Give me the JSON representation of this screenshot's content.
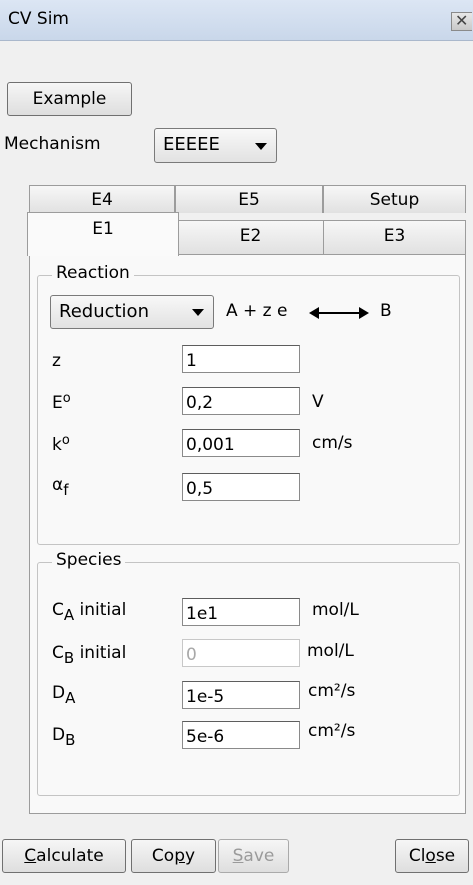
{
  "window": {
    "title": "CV Sim",
    "close_glyph": "✕"
  },
  "example_button": "Example",
  "mechanism": {
    "label": "Mechanism",
    "value": "EEEEE"
  },
  "tabs_back": [
    "E4",
    "E5",
    "Setup"
  ],
  "tabs_front": [
    "E1",
    "E2",
    "E3"
  ],
  "reaction": {
    "title": "Reaction",
    "type_value": "Reduction",
    "equation_left": "A + z e",
    "equation_right": "B",
    "rows": [
      {
        "label": "z",
        "label_sup": "",
        "value": "1",
        "unit": ""
      },
      {
        "label": "E",
        "label_sup": "o",
        "value": "0,2",
        "unit": "V"
      },
      {
        "label": "k",
        "label_sup": "o",
        "value": "0,001",
        "unit": "cm/s"
      },
      {
        "label": "α",
        "label_sub": "f",
        "value": "0,5",
        "unit": ""
      }
    ]
  },
  "species": {
    "title": "Species",
    "rows": [
      {
        "label": "C",
        "sub": "A",
        "suffix": " initial",
        "value": "1e1",
        "unit": "mol/L",
        "enabled": true
      },
      {
        "label": "C",
        "sub": "B",
        "suffix": " initial",
        "value": "0",
        "unit": "mol/L",
        "enabled": false
      },
      {
        "label": "D",
        "sub": "A",
        "suffix": "",
        "value": "1e-5",
        "unit": "cm²/s",
        "enabled": true
      },
      {
        "label": "D",
        "sub": "B",
        "suffix": "",
        "value": "5e-6",
        "unit": "cm²/s",
        "enabled": true
      }
    ]
  },
  "buttons": {
    "calculate": {
      "mnemonic": "C",
      "rest": "alculate"
    },
    "copy": {
      "pre": "Co",
      "mnemonic": "p",
      "rest": "y"
    },
    "save": {
      "mnemonic": "S",
      "rest": "ave"
    },
    "close": {
      "pre": "Cl",
      "mnemonic": "o",
      "rest": "se"
    }
  }
}
